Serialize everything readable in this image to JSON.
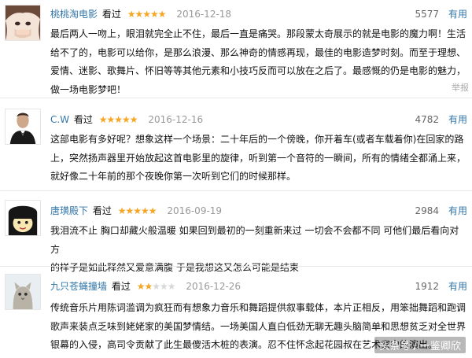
{
  "reviews": [
    {
      "user": "桃桃淘电影",
      "seen": "看过",
      "stars": "★★★★★",
      "stars_off": "",
      "rating": 5,
      "date": "2016-12-18",
      "votes": "5577",
      "useful_label": "有用",
      "lines": [
        "最后两人一吻上，眼泪就完全止不住，最后一直是痛哭。那段蒙太奇展示的就是电影的魔力啊！生活",
        "给不了的，电影可以给你，是那么浪漫、那么神奇的情感再现，最佳的电影造梦时刻。而至于理想、",
        "爱情、迷影、歌舞片、怀旧等等其他元素和小技巧反而可以放在之后了。最感慨的仍是电影的魅力，",
        "做一场电影梦吧！"
      ],
      "report_label": "举报"
    },
    {
      "user": "C.W",
      "seen": "看过",
      "stars": "★★★★★",
      "stars_off": "",
      "rating": 5,
      "date": "2016-12-16",
      "votes": "4782",
      "useful_label": "有用",
      "lines": [
        "这部电影有多好呢？想象这样一个场景：二十年后的一个傍晚，你开着车(或者车载着你)在回家的路",
        "上，突然扬声器里开始放起这首电影里的旋律，听到第一个音符的一瞬间，所有的情绪全都涌上来，",
        "就好像二十年前的那个夜晚你第一次听到它们的时候那样。"
      ]
    },
    {
      "user": "唐璜殿下",
      "seen": "看过",
      "stars": "★★★★★",
      "stars_off": "",
      "rating": 5,
      "date": "2016-09-19",
      "votes": "2984",
      "useful_label": "有用",
      "lines": [
        "我泪流不止 胸口却藏火般温暖 如果回到最初的一刻重新来过 一切会不会都不同 可他们最后看向对方",
        "的样子是如此释然又爱意满腹 于是我想这又怎么可能是结束"
      ]
    },
    {
      "user": "九只苍蝇撞墙",
      "seen": "看过",
      "stars": "★★",
      "stars_off": "★★★",
      "rating": 2,
      "date": "2016-12-26",
      "votes": "1912",
      "useful_label": "有用",
      "lines": [
        "传统音乐片用陈词滥调为疯狂而有想象力音乐和舞蹈提供叙事载体，本片正相反，用笨拙舞蹈和跑调",
        "歌声来装点乏味到姥姥家的美国梦情结。一场美国人直白低劲无聊无趣头脑简单和思想贫乏对全世界",
        "银幕的入侵，高司令贡献了此生最傻活木桩的表演。忍不住怀念起花园叔在艺术家中的演出。"
      ]
    }
  ],
  "watermark": "头条号 / 一鉴卿欣"
}
